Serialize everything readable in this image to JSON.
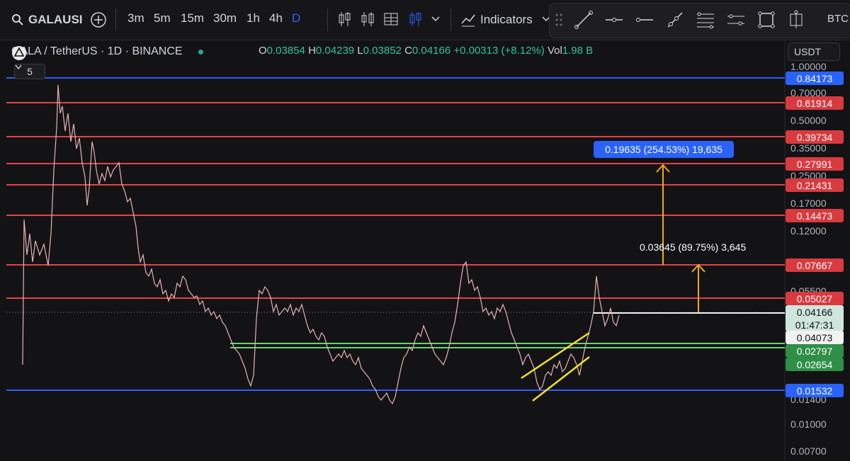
{
  "toolbar": {
    "symbol": "GALAUSI",
    "timeframes": [
      "3m",
      "5m",
      "15m",
      "30m",
      "1h",
      "4h",
      "D"
    ],
    "active_timeframe": "D",
    "indicators_label": "Indicators",
    "right_text": "BTC"
  },
  "legend": {
    "title": "GALA / TetherUS · 1D · BINANCE",
    "open_label": "O",
    "open": "0.03854",
    "high_label": "H",
    "high": "0.04239",
    "low_label": "L",
    "low": "0.03852",
    "close_label": "C",
    "close": "0.04166",
    "change": "+0.00313 (+8.12%)",
    "vol_label": "Vol",
    "vol": "1.98 B",
    "collapse_count": "5"
  },
  "currency": "USDT",
  "axis_ticks": [
    "1.00000",
    "0.70000",
    "0.50000",
    "0.35000",
    "0.25000",
    "0.17000",
    "0.12000",
    "0.05500",
    "0.01400",
    "0.01000",
    "0.00700"
  ],
  "levels": [
    {
      "label": "0.84173",
      "kind": "blue"
    },
    {
      "label": "0.61914",
      "kind": "red"
    },
    {
      "label": "0.39734",
      "kind": "red"
    },
    {
      "label": "0.27991",
      "kind": "red"
    },
    {
      "label": "0.21431",
      "kind": "red"
    },
    {
      "label": "0.14473",
      "kind": "red"
    },
    {
      "label": "0.07667",
      "kind": "red"
    },
    {
      "label": "0.05027",
      "kind": "red"
    },
    {
      "label": "0.04166",
      "kind": "mint"
    },
    {
      "label": "01:47:31",
      "kind": "mint"
    },
    {
      "label": "0.04073",
      "kind": "white"
    },
    {
      "label": "0.02797",
      "kind": "green"
    },
    {
      "label": "0.02654",
      "kind": "green"
    },
    {
      "label": "0.01532",
      "kind": "blue"
    }
  ],
  "measures": {
    "top": "0.19635 (254.53%) 19,635",
    "bottom": "0.03645 (89.75%) 3,645"
  },
  "colors": {
    "red": "#e04347",
    "blue": "#2f5cff",
    "green": "#6ad07a",
    "orange": "#f5a623",
    "yellow": "#f2e02c"
  }
}
